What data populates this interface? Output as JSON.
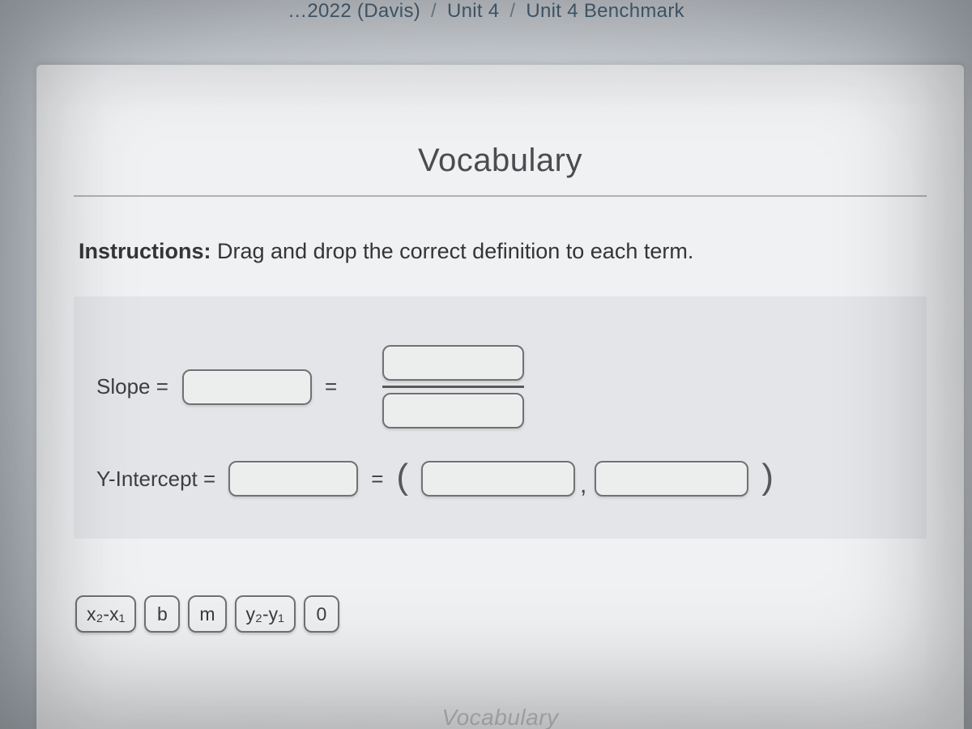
{
  "breadcrumb": {
    "seg1": "…2022 (Davis)",
    "sep": "/",
    "seg2": "Unit 4",
    "seg3": "Unit 4 Benchmark"
  },
  "page": {
    "title": "Vocabulary",
    "instructions_lead": "Instructions:",
    "instructions_body": " Drag and drop the correct definition to each term.",
    "footer_hint": "Vocabulary"
  },
  "terms": {
    "slope": {
      "label": "Slope =",
      "equals": "="
    },
    "yint": {
      "label": "Y-Intercept =",
      "equals": "=",
      "paren_open": "(",
      "comma": ",",
      "paren_close": ")"
    }
  },
  "tiles": {
    "t1": "x₂-x₁",
    "t2": "b",
    "t3": "m",
    "t4": "y₂-y₁",
    "t5": "0"
  }
}
